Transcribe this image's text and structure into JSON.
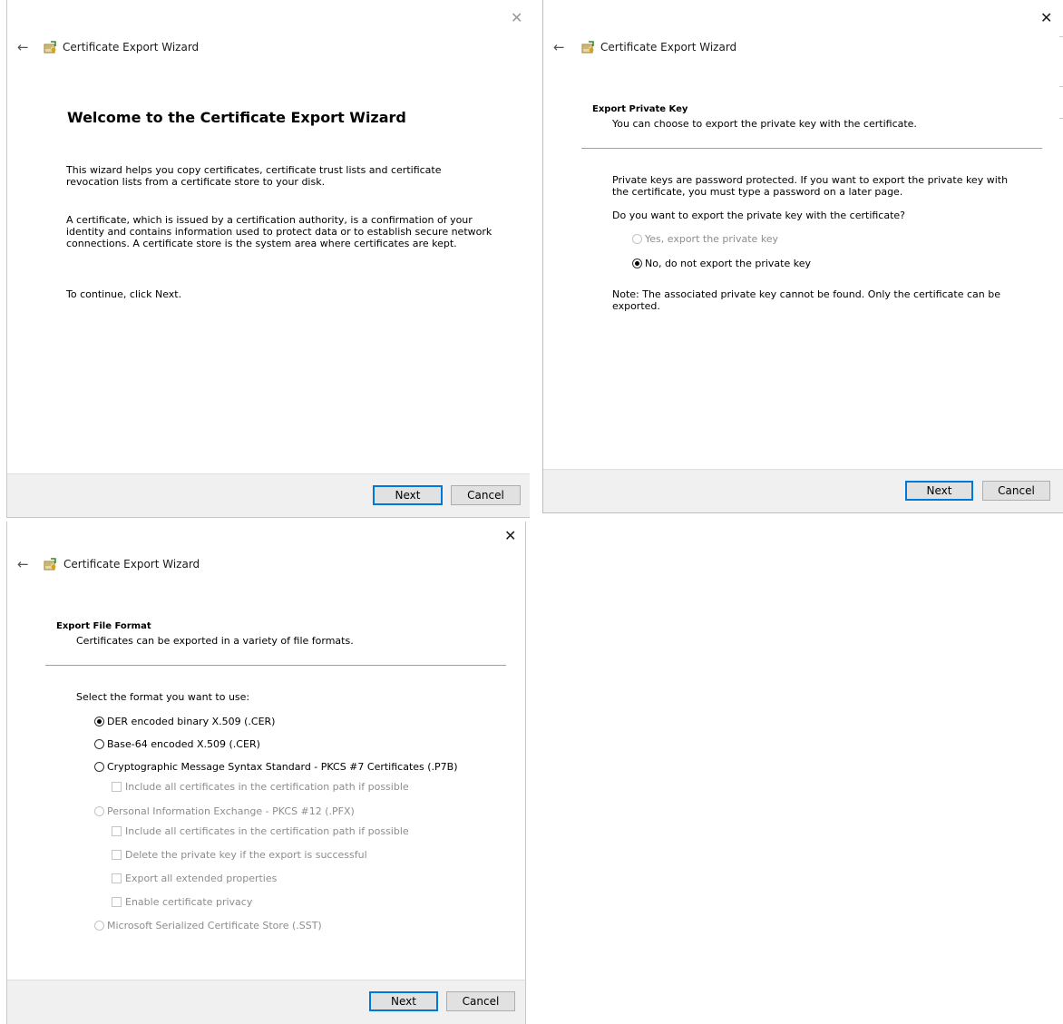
{
  "dialog1": {
    "title": "Certificate Export Wizard",
    "heading": "Welcome to the Certificate Export Wizard",
    "para1": "This wizard helps you copy certificates, certificate trust lists and certificate revocation lists from a certificate store to your disk.",
    "para2": "A certificate, which is issued by a certification authority, is a confirmation of your identity and contains information used to protect data or to establish secure network connections. A certificate store is the system area where certificates are kept.",
    "para3": "To continue, click Next.",
    "next_label": "Next",
    "cancel_label": "Cancel"
  },
  "dialog2": {
    "title": "Certificate Export Wizard",
    "section_title": "Export Private Key",
    "section_desc": "You can choose to export the private key with the certificate.",
    "para1": "Private keys are password protected. If you want to export the private key with the certificate, you must type a password on a later page.",
    "question": "Do you want to export the private key with the certificate?",
    "options": [
      {
        "label": "Yes, export the private key",
        "checked": false,
        "disabled": true
      },
      {
        "label": "No, do not export the private key",
        "checked": true,
        "disabled": false
      }
    ],
    "note": "Note: The associated private key cannot be found. Only the certificate can be exported.",
    "next_label": "Next",
    "cancel_label": "Cancel"
  },
  "dialog3": {
    "title": "Certificate Export Wizard",
    "section_title": "Export File Format",
    "section_desc": "Certificates can be exported in a variety of file formats.",
    "prompt": "Select the format you want to use:",
    "formats": [
      {
        "label": "DER encoded binary X.509 (.CER)",
        "checked": true,
        "disabled": false
      },
      {
        "label": "Base-64 encoded X.509 (.CER)",
        "checked": false,
        "disabled": false
      },
      {
        "label": "Cryptographic Message Syntax Standard - PKCS #7 Certificates (.P7B)",
        "checked": false,
        "disabled": false
      },
      {
        "label": "Personal Information Exchange - PKCS #12 (.PFX)",
        "checked": false,
        "disabled": true
      },
      {
        "label": "Microsoft Serialized Certificate Store (.SST)",
        "checked": false,
        "disabled": true
      }
    ],
    "p7b_checkbox": "Include all certificates in the certification path if possible",
    "pfx_checkboxes": [
      "Include all certificates in the certification path if possible",
      "Delete the private key if the export is successful",
      "Export all extended properties",
      "Enable certificate privacy"
    ],
    "next_label": "Next",
    "cancel_label": "Cancel"
  },
  "colors": {
    "footer_bg": "#f0f0f0",
    "primary_border": "#0078d7",
    "disabled_text": "#8d8d8d"
  },
  "icons": {
    "close": "close-icon",
    "back": "back-arrow-icon",
    "wizard": "certificate-wizard-icon"
  }
}
